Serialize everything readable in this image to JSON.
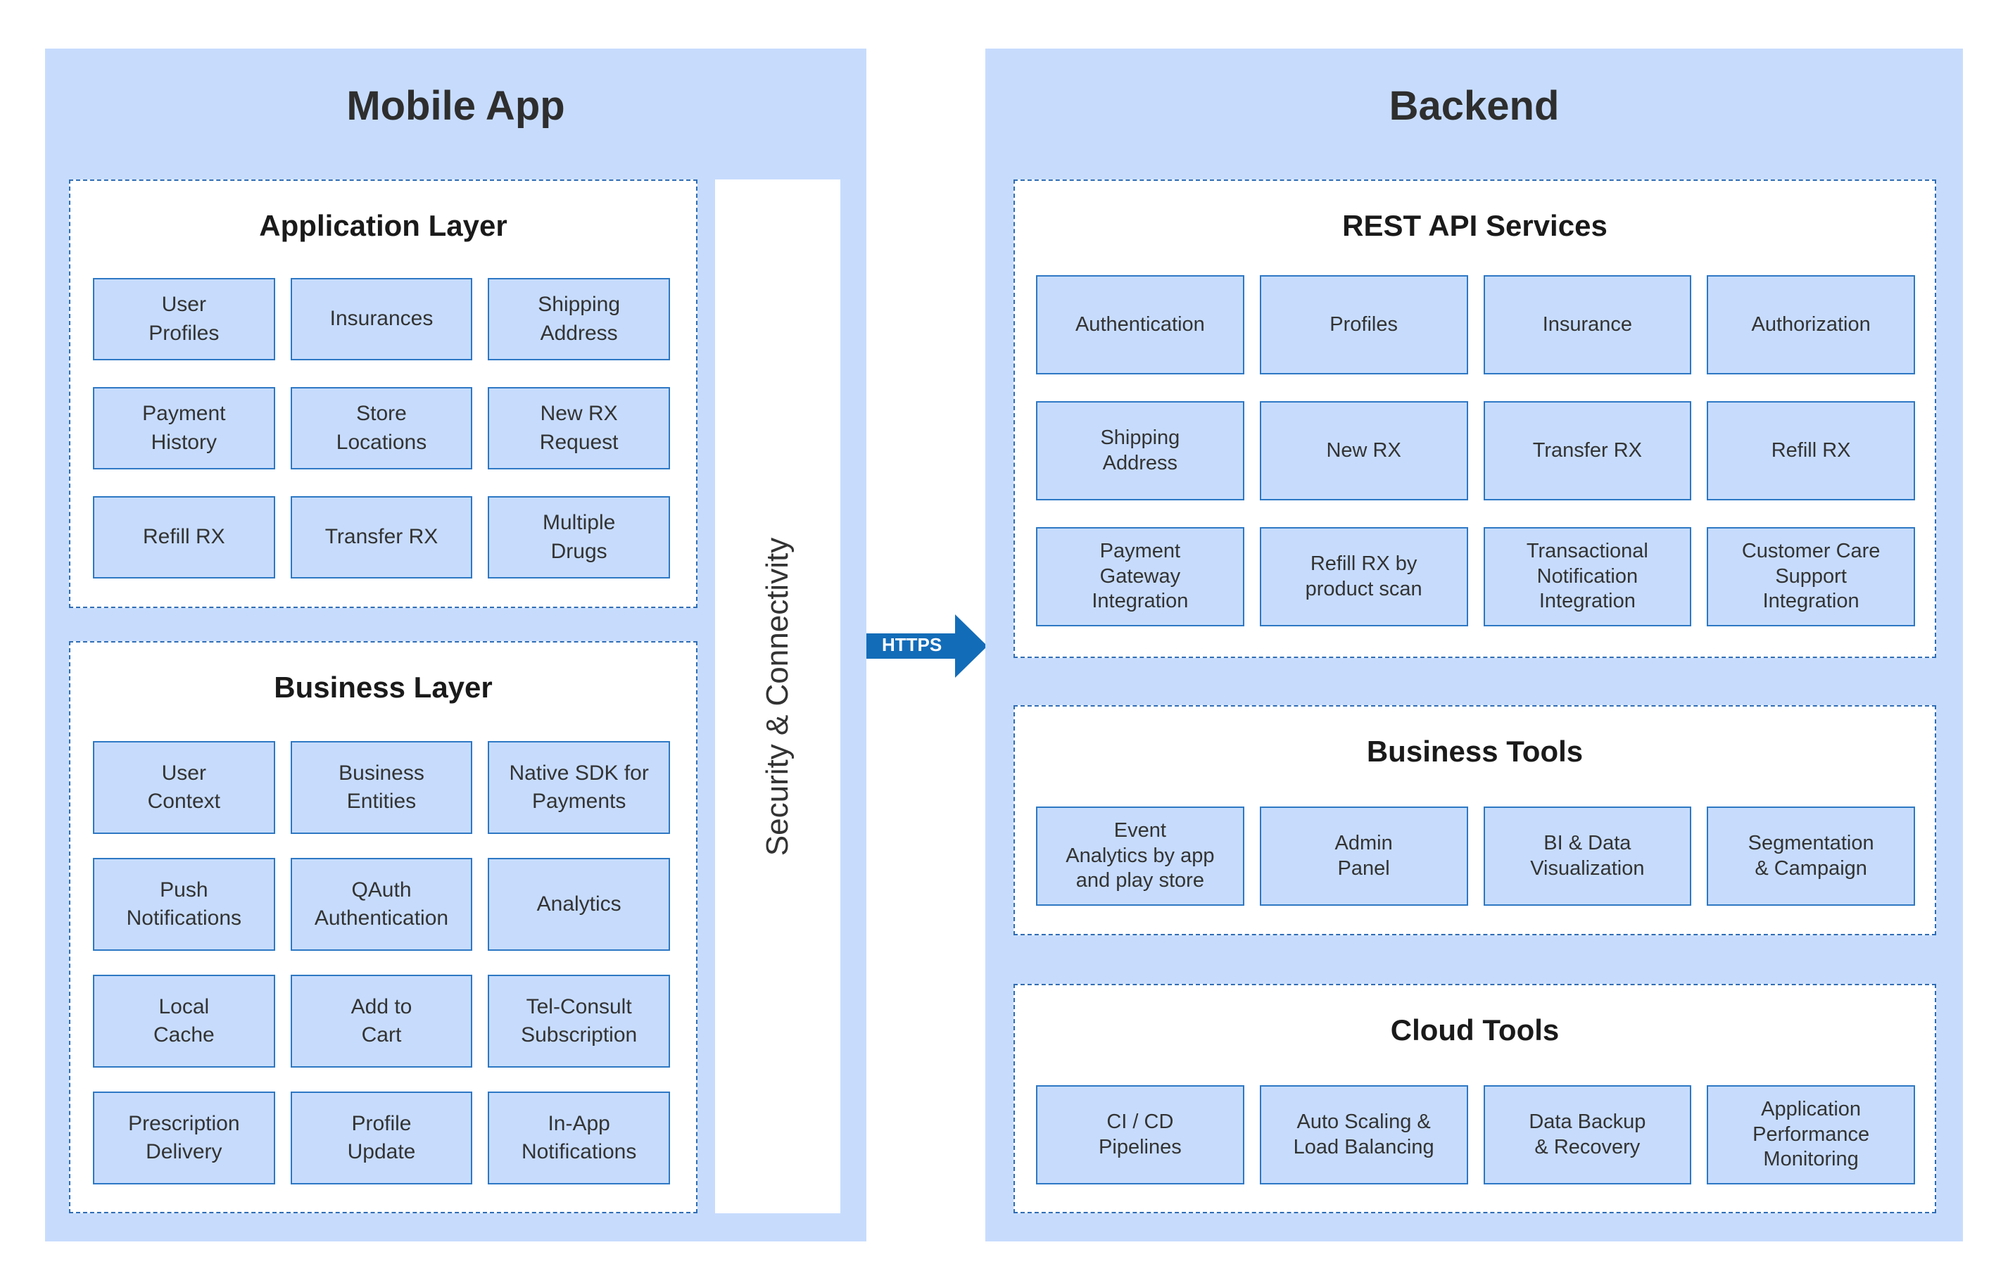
{
  "mobile_app": {
    "title": "Mobile App",
    "application_layer": {
      "title": "Application Layer",
      "items": [
        "User\nProfiles",
        "Insurances",
        "Shipping\nAddress",
        "Payment\nHistory",
        "Store\nLocations",
        "New RX\nRequest",
        "Refill RX",
        "Transfer RX",
        "Multiple\nDrugs"
      ]
    },
    "business_layer": {
      "title": "Business Layer",
      "items": [
        "User\nContext",
        "Business\nEntities",
        "Native SDK for\nPayments",
        "Push\nNotifications",
        "QAuth\nAuthentication",
        "Analytics",
        "Local\nCache",
        "Add to\nCart",
        "Tel-Consult\nSubscription",
        "Prescription\nDelivery",
        "Profile\nUpdate",
        "In-App\nNotifications"
      ]
    },
    "security_label": "Security & Connectivity"
  },
  "connector": {
    "label": "HTTPS",
    "color": "#136cb8"
  },
  "backend": {
    "title": "Backend",
    "rest_api": {
      "title": "REST API Services",
      "items": [
        "Authentication",
        "Profiles",
        "Insurance",
        "Authorization",
        "Shipping\nAddress",
        "New RX",
        "Transfer RX",
        "Refill RX",
        "Payment\nGateway\nIntegration",
        "Refill RX by\nproduct scan",
        "Transactional\nNotification\nIntegration",
        "Customer Care\nSupport\nIntegration"
      ]
    },
    "business_tools": {
      "title": "Business Tools",
      "items": [
        "Event\nAnalytics by app\nand play store",
        "Admin\nPanel",
        "BI & Data\nVisualization",
        "Segmentation\n& Campaign"
      ]
    },
    "cloud_tools": {
      "title": "Cloud Tools",
      "items": [
        "CI / CD\nPipelines",
        "Auto Scaling &\nLoad Balancing",
        "Data Backup\n& Recovery",
        "Application\nPerformance\nMonitoring"
      ]
    }
  },
  "colors": {
    "panel": "#c7dcfd",
    "box_border": "#2e78c4",
    "dashed_border": "#2f6db5",
    "arrow": "#136cb8"
  }
}
